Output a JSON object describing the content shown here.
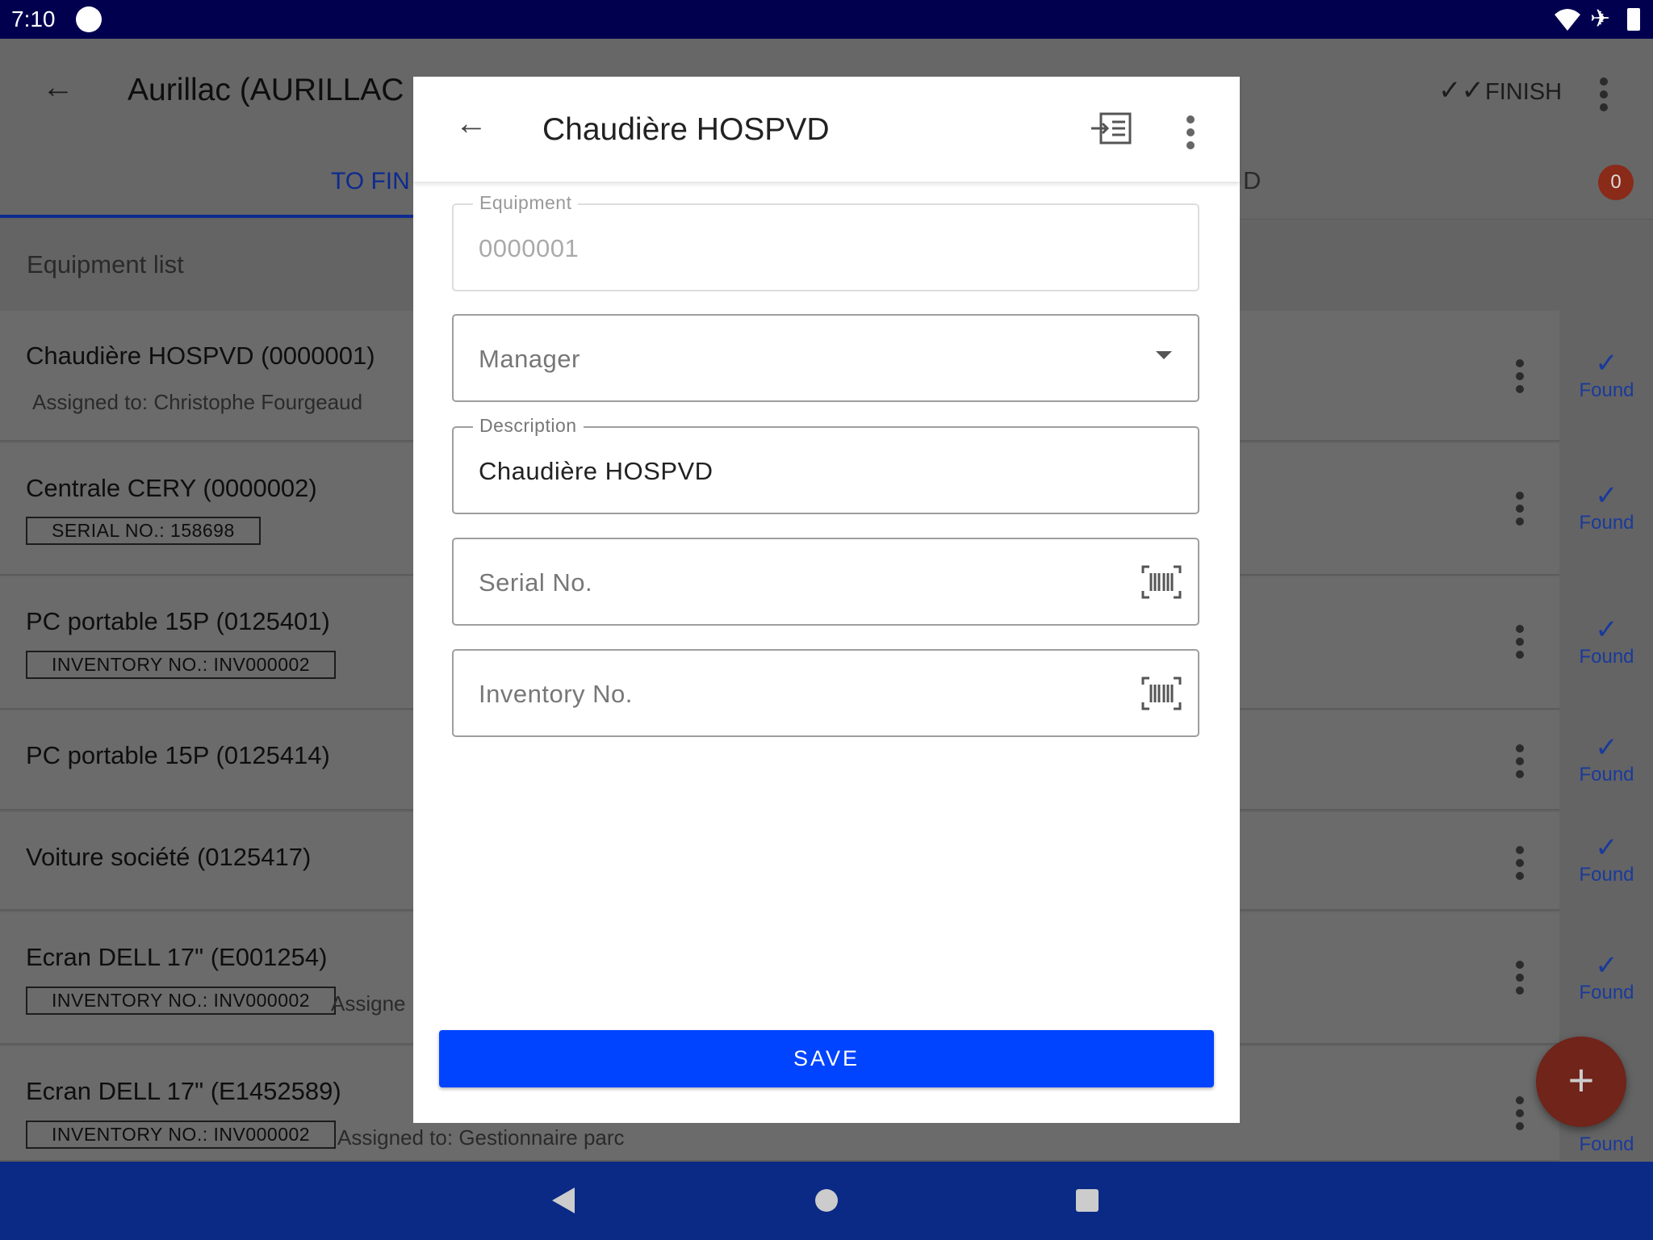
{
  "status_bar": {
    "time": "7:10",
    "icons": [
      "wifi-icon",
      "airplane-icon",
      "battery-icon"
    ]
  },
  "app_bar": {
    "title": "Aurillac (AURILLAC",
    "finish_label": "FINISH",
    "tab_active": "TO FIN",
    "tab_other": "D",
    "badge_count": "0"
  },
  "list": {
    "header": "Equipment list",
    "items": [
      {
        "title": "Chaudière HOSPVD (0000001)",
        "subtitle": "Assigned to: Christophe Fourgeaud",
        "status": "Found"
      },
      {
        "title": "Centrale CERY (0000002)",
        "tag": "SERIAL NO.: 158698",
        "status": "Found"
      },
      {
        "title": "PC portable 15P (0125401)",
        "tag": "INVENTORY NO.: INV000002",
        "status": "Found"
      },
      {
        "title": "PC portable 15P (0125414)",
        "status": "Found"
      },
      {
        "title": "Voiture société (0125417)",
        "status": "Found"
      },
      {
        "title": "Ecran DELL 17\" (E001254)",
        "tag": "INVENTORY NO.: INV000002",
        "subtitle": "Assigne",
        "status": "Found"
      },
      {
        "title": "Ecran DELL 17\" (E1452589)",
        "tag": "INVENTORY NO.: INV000002",
        "subtitle": "Assigned to: Gestionnaire parc",
        "status": "Found"
      }
    ]
  },
  "dialog": {
    "title": "Chaudière HOSPVD",
    "equipment": {
      "label": "Equipment",
      "value": "0000001"
    },
    "manager": {
      "placeholder": "Manager"
    },
    "description": {
      "label": "Description",
      "value": "Chaudière HOSPVD"
    },
    "serial": {
      "placeholder": "Serial No."
    },
    "inventory": {
      "placeholder": "Inventory No."
    },
    "save_label": "SAVE"
  },
  "colors": {
    "status_bar": "#00004f",
    "accent": "#0044ff",
    "fab": "#c0391b",
    "nav_bar": "#0b2a86",
    "found": "#1a3fb0"
  }
}
